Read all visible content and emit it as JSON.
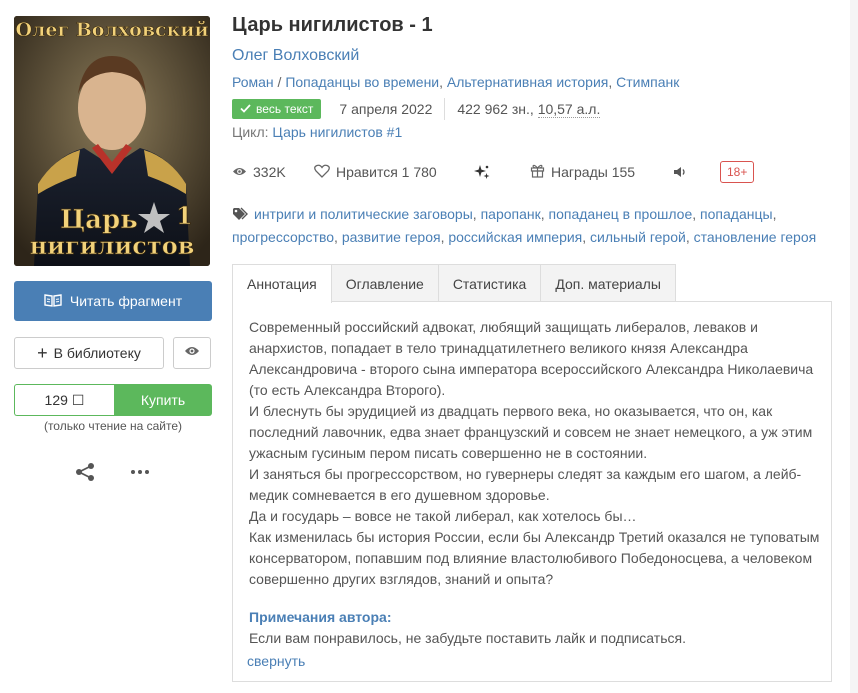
{
  "book": {
    "title": "Царь нигилистов - 1",
    "author": "Олег Волховский",
    "genres": [
      "Роман",
      "Попаданцы во времени",
      "Альтернативная история",
      "Стимпанк"
    ],
    "genre_sep1": " / ",
    "genre_sep2": ", ",
    "badge": "весь текст",
    "date": "7 апреля 2022",
    "size_chars": "422 962 зн., ",
    "size_al": "10,57 а.л.",
    "cycle_label": "Цикл: ",
    "cycle_name": "Царь нигилистов #1"
  },
  "cover": {
    "author": "Олег Волховский",
    "title_line1": "Царь",
    "title_num": "1",
    "title_line2": "нигилистов"
  },
  "stats": {
    "views": "332K",
    "likes": "Нравится 1 780",
    "awards": "Награды 155",
    "age": "18+"
  },
  "tags": [
    "интриги и политические заговоры",
    "паропанк",
    "попаданец в прошлое",
    "попаданцы",
    "прогрессорство",
    "развитие героя",
    "российская империя",
    "сильный герой",
    "становление героя"
  ],
  "actions": {
    "read": "Читать фрагмент",
    "library": "В библиотеку",
    "price": "129",
    "currency": "☐",
    "buy": "Купить",
    "buy_note": "(только чтение на сайте)"
  },
  "tabs": [
    "Аннотация",
    "Оглавление",
    "Статистика",
    "Доп. материалы"
  ],
  "annotation": [
    "Современный российский адвокат, любящий защищать либералов, леваков и анархистов, попадает в тело тринадцатилетнего великого князя Александра Александровича - второго сына императора всероссийского Александра Николаевича (то есть Александра Второго).",
    "И блеснуть бы эрудицией из двадцать первого века, но оказывается, что он, как последний лавочник, едва знает французский и совсем не знает немецкого, а уж этим ужасным гусиным пером писать совершенно не в состоянии.",
    "И заняться бы прогрессорством, но гувернеры следят за каждым его шагом, а лейб-медик сомневается в его душевном здоровье.",
    "Да и государь – вовсе не такой либерал, как хотелось бы…",
    "Как изменилась бы история России, если бы Александр Третий оказался не туповатым консерватором, попавшим под влияние властолюбивого Победоносцева, а человеком совершенно других взглядов, знаний и опыта?"
  ],
  "notes": {
    "title": "Примечания автора:",
    "text": "Если вам понравилось, не забудьте поставить лайк и подписаться.",
    "collapse": "свернуть"
  },
  "colors": {
    "link": "#4a7fb5",
    "read_button": "#4a7fb5",
    "buy_green": "#5cb85c",
    "age_red": "#d9534f"
  }
}
